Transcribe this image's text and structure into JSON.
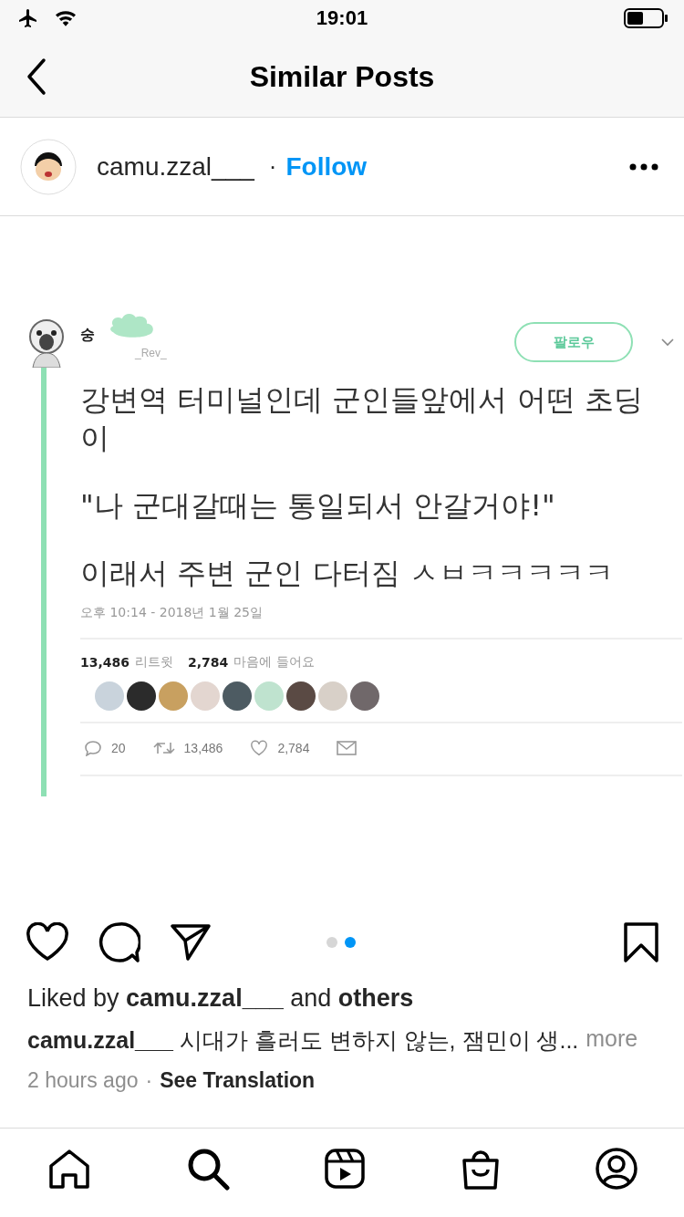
{
  "status_bar": {
    "time": "19:01"
  },
  "nav": {
    "title": "Similar Posts"
  },
  "post_header": {
    "username": "camu.zzal___",
    "separator": "·",
    "follow": "Follow"
  },
  "tweet": {
    "name": "숭",
    "handle": "_Rev_",
    "follow_button": "팔로우",
    "paragraphs": [
      "강변역 터미널인데 군인들앞에서 어떤 초딩이",
      "\"나 군대갈때는 통일되서 안갈거야!\"",
      "이래서 주변 군인 다터짐 ㅅㅂㅋㅋㅋㅋㅋ"
    ],
    "timestamp": "오후 10:14 - 2018년 1월 25일",
    "retweets_count": "13,486",
    "retweets_label": "리트윗",
    "likes_count": "2,784",
    "likes_label": "마음에 들어요",
    "avatars": [
      {
        "color": "#c9d3dc"
      },
      {
        "color": "#2b2b2b"
      },
      {
        "color": "#c8a060"
      },
      {
        "color": "#e3d6d0"
      },
      {
        "color": "#4d5b62"
      },
      {
        "color": "#bfe3cf"
      },
      {
        "color": "#5a4a44"
      },
      {
        "color": "#d8d0c8"
      },
      {
        "color": "#70686a"
      }
    ],
    "replies": "20",
    "retweets": "13,486",
    "likes": "2,784"
  },
  "carousel": [
    {
      "selected": false
    },
    {
      "selected": true
    }
  ],
  "liked_by": "Liked by **camu.zzal___** and **others**",
  "caption": {
    "username": "camu.zzal___",
    "text": "시대가 흘러도 변하지 않는, 잼민이 생...",
    "more": "more"
  },
  "time": "2 hours ago",
  "separator": "·",
  "translation": "See Translation"
}
